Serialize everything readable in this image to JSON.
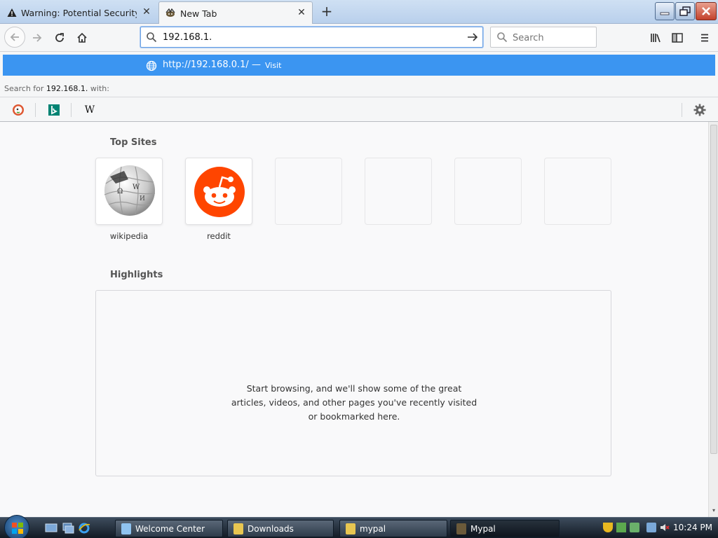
{
  "window": {
    "tabs": [
      {
        "label": "Warning: Potential Security Risk Ahead",
        "close": "✕"
      },
      {
        "label": "New Tab",
        "close": "✕"
      }
    ],
    "new_tab": "+"
  },
  "navbar": {
    "url_value": "192.168.1.",
    "search_placeholder": "Search"
  },
  "dropdown": {
    "suggestion_url": "http://192.168.0.1/",
    "suggestion_sep": "—",
    "suggestion_action": "Visit",
    "search_prefix": "Search for",
    "search_term": "192.168.1.",
    "search_suffix": "with:",
    "engines": [
      "DuckDuckGo",
      "Bing",
      "Wikipedia"
    ],
    "wiki_glyph": "W"
  },
  "content": {
    "top_sites_title": "Top Sites",
    "sites": [
      {
        "label": "wikipedia"
      },
      {
        "label": "reddit"
      }
    ],
    "highlights_title": "Highlights",
    "highlights_message": "Start browsing, and we'll show some of the great articles, videos, and other pages you've recently visited or bookmarked here."
  },
  "taskbar": {
    "tasks": [
      {
        "label": "Welcome Center"
      },
      {
        "label": "Downloads"
      },
      {
        "label": "mypal"
      },
      {
        "label": "Mypal"
      }
    ],
    "clock": "10:24 PM"
  },
  "colors": {
    "accent": "#3b95f1",
    "reddit": "#ff4500"
  }
}
